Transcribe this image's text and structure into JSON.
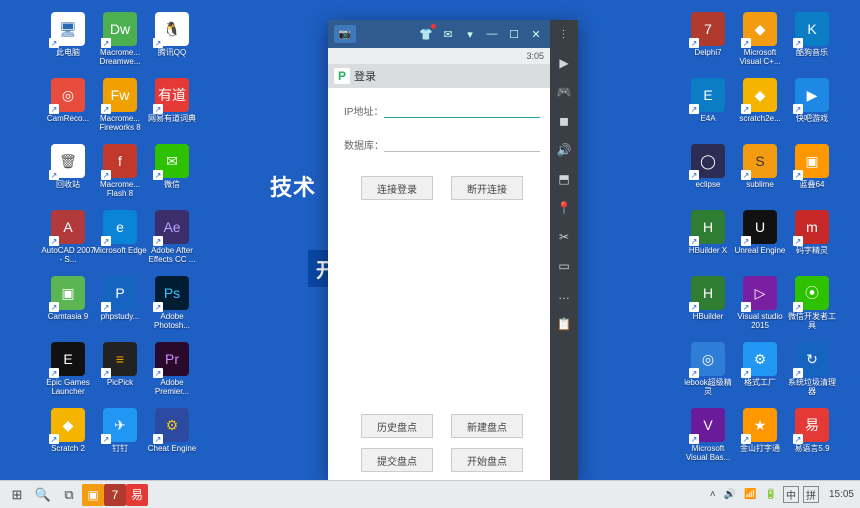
{
  "wallpaper": {
    "line1": "技术",
    "line2": "开"
  },
  "desktop": {
    "left_cols": [
      [
        {
          "label": "此电脑",
          "bg": "#ffffff",
          "fg": "#2b6cb0",
          "glyph": "🖥"
        },
        {
          "label": "CamReco...",
          "bg": "#e74c3c",
          "fg": "#fff",
          "glyph": "◎"
        },
        {
          "label": "回收站",
          "bg": "#ffffff",
          "fg": "#555",
          "glyph": "🗑"
        },
        {
          "label": "AutoCAD 2007 - S...",
          "bg": "#b23a3a",
          "fg": "#fff",
          "glyph": "A"
        },
        {
          "label": "Camtasia 9",
          "bg": "#5ab552",
          "fg": "#fff",
          "glyph": "▣"
        },
        {
          "label": "Epic Games Launcher",
          "bg": "#111",
          "fg": "#fff",
          "glyph": "E"
        },
        {
          "label": "Scratch 2",
          "bg": "#f4b400",
          "fg": "#fff",
          "glyph": "◆"
        }
      ],
      [
        {
          "label": "Macrome... Dreamwe...",
          "bg": "#4caf50",
          "fg": "#fff",
          "glyph": "Dw"
        },
        {
          "label": "Macrome... Fireworks 8",
          "bg": "#f0a000",
          "fg": "#fff",
          "glyph": "Fw"
        },
        {
          "label": "Macrome... Flash 8",
          "bg": "#c0392b",
          "fg": "#fff",
          "glyph": "f"
        },
        {
          "label": "Microsoft Edge",
          "bg": "#0a84d4",
          "fg": "#fff",
          "glyph": "e"
        },
        {
          "label": "phpstudy...",
          "bg": "#1565c0",
          "fg": "#fff",
          "glyph": "P"
        },
        {
          "label": "PicPick",
          "bg": "#222",
          "fg": "#f0a000",
          "glyph": "≡"
        },
        {
          "label": "钉钉",
          "bg": "#2196f3",
          "fg": "#fff",
          "glyph": "✈"
        }
      ],
      [
        {
          "label": "腾讯QQ",
          "bg": "#fff",
          "fg": "#000",
          "glyph": "🐧"
        },
        {
          "label": "网易有道词典",
          "bg": "#e53935",
          "fg": "#fff",
          "glyph": "有道"
        },
        {
          "label": "微信",
          "bg": "#2dc100",
          "fg": "#fff",
          "glyph": "✉"
        },
        {
          "label": "Adobe After Effects CC ...",
          "bg": "#3b2e6b",
          "fg": "#b8a6ff",
          "glyph": "Ae"
        },
        {
          "label": "Adobe Photosh...",
          "bg": "#001d34",
          "fg": "#3ac1ff",
          "glyph": "Ps"
        },
        {
          "label": "Adobe Premier...",
          "bg": "#2a0a2a",
          "fg": "#d08bff",
          "glyph": "Pr"
        },
        {
          "label": "Cheat Engine",
          "bg": "#2b4aa0",
          "fg": "#f5c518",
          "glyph": "⚙"
        }
      ]
    ],
    "right_cols": [
      [
        {
          "label": "Delphi7",
          "bg": "#b03a2e",
          "fg": "#fff",
          "glyph": "7"
        },
        {
          "label": "E4A",
          "bg": "#0a7dc4",
          "fg": "#fff",
          "glyph": "E"
        },
        {
          "label": "eclipse",
          "bg": "#2c2c54",
          "fg": "#fff",
          "glyph": "◯"
        },
        {
          "label": "HBuilder X",
          "bg": "#2e7d32",
          "fg": "#fff",
          "glyph": "H"
        },
        {
          "label": "HBuilder",
          "bg": "#2e7d32",
          "fg": "#fff",
          "glyph": "H"
        },
        {
          "label": "iebook超级精灵",
          "bg": "#2e7dd6",
          "fg": "#fff",
          "glyph": "◎"
        },
        {
          "label": "Microsoft Visual Bas...",
          "bg": "#6a1b9a",
          "fg": "#fff",
          "glyph": "V"
        }
      ],
      [
        {
          "label": "Microsoft Visual C+...",
          "bg": "#f39c12",
          "fg": "#fff",
          "glyph": "◆"
        },
        {
          "label": "scratch2e...",
          "bg": "#f4b400",
          "fg": "#fff",
          "glyph": "◆"
        },
        {
          "label": "sublime",
          "bg": "#f39c12",
          "fg": "#333",
          "glyph": "S"
        },
        {
          "label": "Unreal Engine",
          "bg": "#111",
          "fg": "#fff",
          "glyph": "U"
        },
        {
          "label": "Visual studio 2015",
          "bg": "#7b1fa2",
          "fg": "#fff",
          "glyph": "▷"
        },
        {
          "label": "格式工厂",
          "bg": "#2196f3",
          "fg": "#fff",
          "glyph": "⚙"
        },
        {
          "label": "金山打字通",
          "bg": "#ff9800",
          "fg": "#fff",
          "glyph": "★"
        }
      ],
      [
        {
          "label": "酷狗音乐",
          "bg": "#0a7dc4",
          "fg": "#fff",
          "glyph": "K"
        },
        {
          "label": "快吧游戏",
          "bg": "#1e88e5",
          "fg": "#fff",
          "glyph": "▶"
        },
        {
          "label": "蓝叠64",
          "bg": "#ff9800",
          "fg": "#fff",
          "glyph": "▣"
        },
        {
          "label": "码字精灵",
          "bg": "#c62828",
          "fg": "#fff",
          "glyph": "m"
        },
        {
          "label": "微信开发者工具",
          "bg": "#2dc100",
          "fg": "#fff",
          "glyph": "⦿"
        },
        {
          "label": "系统垃圾清理器",
          "bg": "#1565c0",
          "fg": "#fff",
          "glyph": "↻"
        },
        {
          "label": "易语言5.9",
          "bg": "#e53935",
          "fg": "#fff",
          "glyph": "易"
        }
      ]
    ]
  },
  "emulator": {
    "status_time": "3:05",
    "header_title": "登录",
    "form": {
      "ip_label": "IP地址：",
      "ip_value": "",
      "db_label": "数据库：",
      "db_value": ""
    },
    "buttons": {
      "connect": "连接登录",
      "disconnect": "断开连接",
      "history": "历史盘点",
      "new": "新建盘点",
      "submit": "提交盘点",
      "start": "开始盘点"
    },
    "titlebar_icons": {
      "tab": "📷",
      "shirt": "👕",
      "mail": "✉",
      "down": "▾",
      "min": "—",
      "max": "☐",
      "close": "✕"
    },
    "side_icons": [
      "⋮",
      "▶",
      "🎮",
      "◼",
      "🔊",
      "⬒",
      "📍",
      "✂",
      "▭",
      "…",
      "📋"
    ]
  },
  "taskbar": {
    "start": "⊞",
    "search": "🔍",
    "taskview": "⧉",
    "pins": [
      {
        "glyph": "▣",
        "bg": "#f39c12"
      },
      {
        "glyph": "7",
        "bg": "#b03a2e"
      },
      {
        "glyph": "易",
        "bg": "#e53935"
      }
    ],
    "tray": {
      "chevron": "˄",
      "volume": "🔊",
      "net": "📶",
      "battery": "🔋",
      "ime1": "中",
      "ime2": "拼",
      "time": "15:05"
    }
  }
}
